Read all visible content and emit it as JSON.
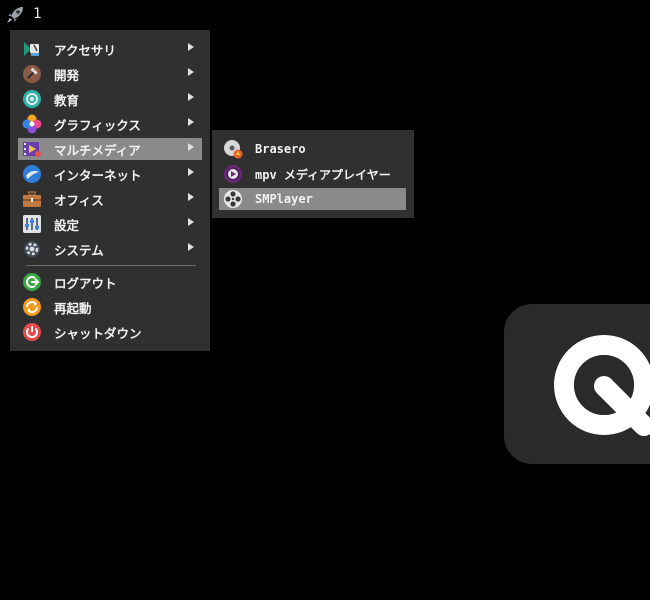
{
  "panel": {
    "launcher_icon": "rocket-icon",
    "workspace": "1"
  },
  "main_menu": {
    "items": [
      {
        "label": "アクセサリ",
        "icon": "accessories-icon",
        "submenu": true
      },
      {
        "label": "開発",
        "icon": "development-hammer-icon",
        "submenu": true
      },
      {
        "label": "教育",
        "icon": "education-icon",
        "submenu": true
      },
      {
        "label": "グラフィックス",
        "icon": "graphics-icon",
        "submenu": true
      },
      {
        "label": "マルチメディア",
        "icon": "multimedia-icon",
        "submenu": true,
        "selected": true
      },
      {
        "label": "インターネット",
        "icon": "internet-icon",
        "submenu": true
      },
      {
        "label": "オフィス",
        "icon": "office-briefcase-icon",
        "submenu": true
      },
      {
        "label": "設定",
        "icon": "settings-icon",
        "submenu": true
      },
      {
        "label": "システム",
        "icon": "system-gear-icon",
        "submenu": true
      }
    ],
    "session": [
      {
        "label": "ログアウト",
        "icon": "logout-icon"
      },
      {
        "label": "再起動",
        "icon": "reboot-icon"
      },
      {
        "label": "シャットダウン",
        "icon": "shutdown-icon"
      }
    ]
  },
  "sub_menu": {
    "items": [
      {
        "label": "Brasero",
        "icon": "brasero-disc-icon"
      },
      {
        "label": "mpv メディアプレイヤー",
        "icon": "mpv-icon"
      },
      {
        "label": "SMPlayer",
        "icon": "smplayer-icon",
        "selected": true
      }
    ]
  },
  "colors": {
    "menu_bg": "#303030",
    "selected_bg": "#8a8a8a",
    "desktop_bg": "#000000"
  }
}
